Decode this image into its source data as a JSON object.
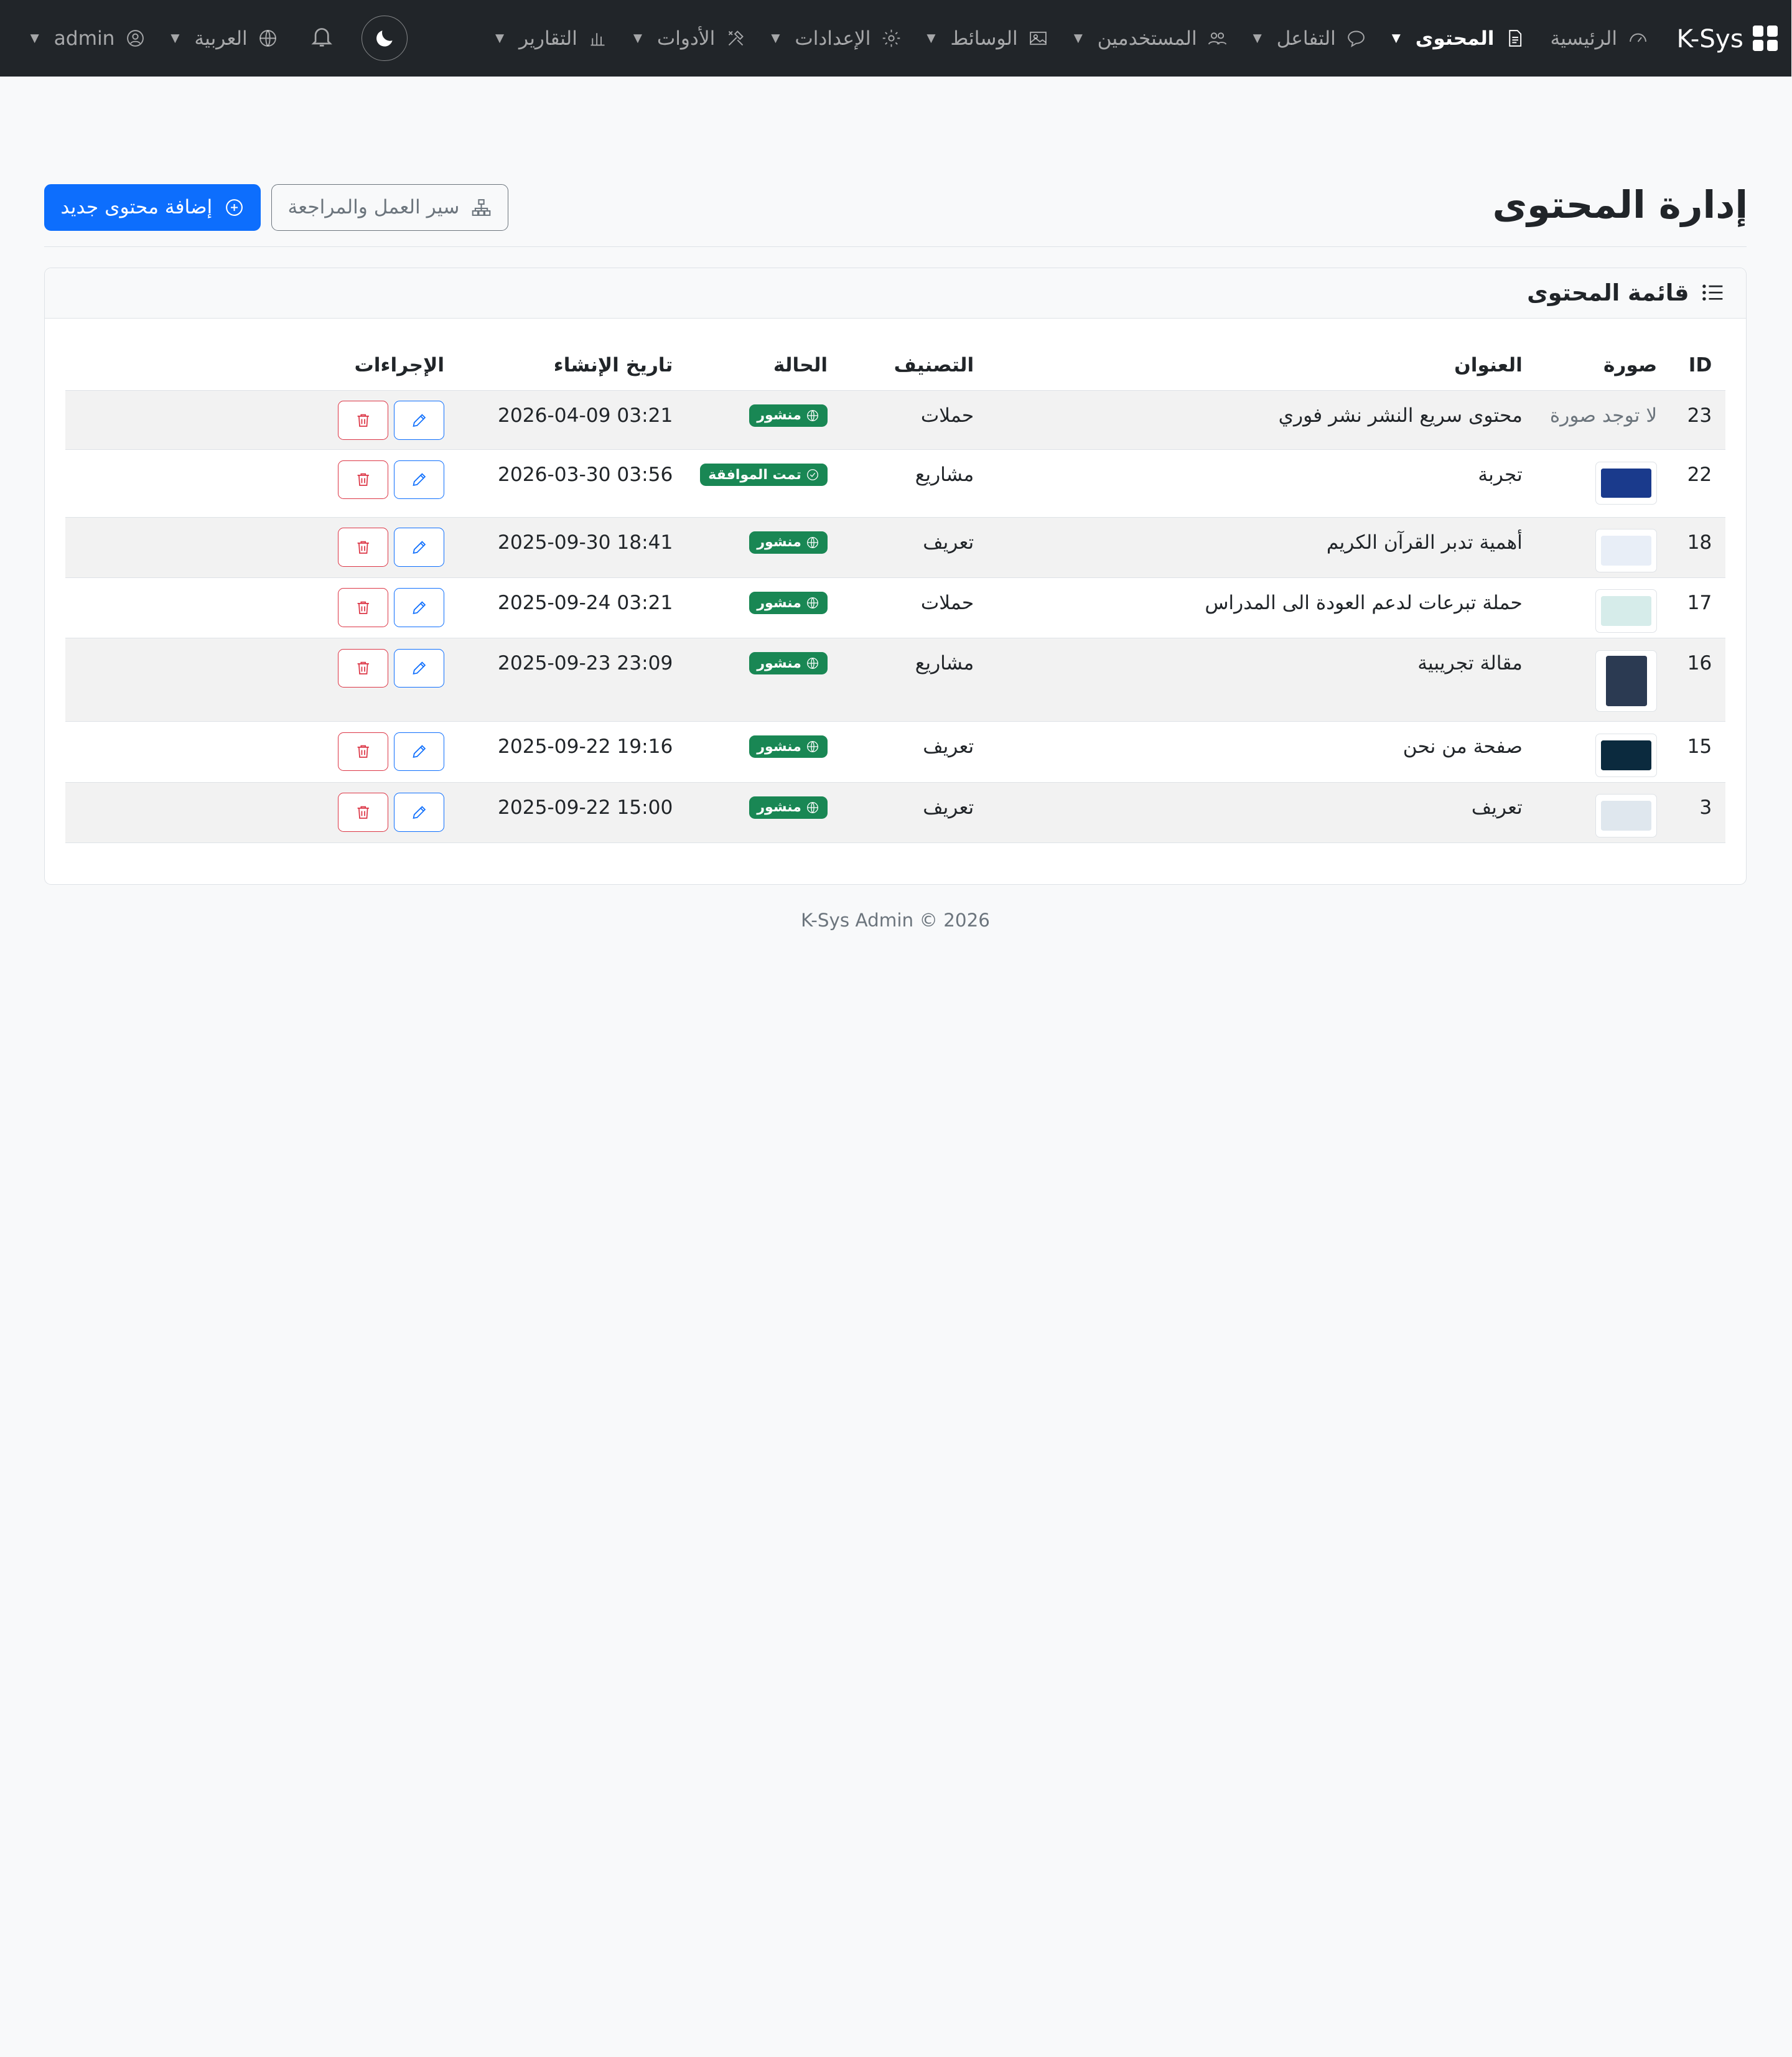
{
  "navbar": {
    "brand": "K-Sys",
    "items": [
      {
        "label": "الرئيسية",
        "icon": "speedometer-icon",
        "dropdown": false,
        "active": false
      },
      {
        "label": "المحتوى",
        "icon": "file-text-icon",
        "dropdown": true,
        "active": true
      },
      {
        "label": "التفاعل",
        "icon": "chat-icon",
        "dropdown": true,
        "active": false
      },
      {
        "label": "المستخدمين",
        "icon": "people-icon",
        "dropdown": true,
        "active": false
      },
      {
        "label": "الوسائط",
        "icon": "image-icon",
        "dropdown": true,
        "active": false
      },
      {
        "label": "الإعدادات",
        "icon": "gear-icon",
        "dropdown": true,
        "active": false
      },
      {
        "label": "الأدوات",
        "icon": "tools-icon",
        "dropdown": true,
        "active": false
      },
      {
        "label": "التقارير",
        "icon": "bar-chart-icon",
        "dropdown": true,
        "active": false
      }
    ],
    "language": "العربية",
    "user": "admin"
  },
  "header": {
    "title": "إدارة المحتوى",
    "workflow_button": "سير العمل والمراجعة",
    "add_button": "إضافة محتوى جديد"
  },
  "card": {
    "title": "قائمة المحتوى",
    "columns": [
      "ID",
      "صورة",
      "العنوان",
      "التصنيف",
      "الحالة",
      "تاريخ الإنشاء",
      "الإجراءات"
    ],
    "rows": [
      {
        "id": "23",
        "image": "none",
        "image_text": "لا توجد صورة",
        "title": "محتوى سريع النشر نشر فوري",
        "category": "حملات",
        "status": "منشور",
        "status_kind": "published",
        "date": "2026-04-09 03:21",
        "thumb_color": ""
      },
      {
        "id": "22",
        "image": "thumb",
        "image_text": "",
        "title": "تجربة",
        "category": "مشاريع",
        "status": "تمت الموافقة",
        "status_kind": "approved",
        "date": "2026-03-30 03:56",
        "thumb_color": "#1a3a8c"
      },
      {
        "id": "18",
        "image": "thumb",
        "image_text": "",
        "title": "أهمية تدبر القرآن الكريم",
        "category": "تعريف",
        "status": "منشور",
        "status_kind": "published",
        "date": "2025-09-30 18:41",
        "thumb_color": "#e8eef7"
      },
      {
        "id": "17",
        "image": "thumb",
        "image_text": "",
        "title": "حملة تبرعات لدعم العودة الى المدراس",
        "category": "حملات",
        "status": "منشور",
        "status_kind": "published",
        "date": "2025-09-24 03:21",
        "thumb_color": "#d6ecea"
      },
      {
        "id": "16",
        "image": "thumb-tall",
        "image_text": "",
        "title": "مقالة تجريبية",
        "category": "مشاريع",
        "status": "منشور",
        "status_kind": "published",
        "date": "2025-09-23 23:09",
        "thumb_color": "#2b3a52"
      },
      {
        "id": "15",
        "image": "thumb",
        "image_text": "",
        "title": "صفحة من نحن",
        "category": "تعريف",
        "status": "منشور",
        "status_kind": "published",
        "date": "2025-09-22 19:16",
        "thumb_color": "#0b2a3e"
      },
      {
        "id": "3",
        "image": "thumb",
        "image_text": "",
        "title": "تعريف",
        "category": "تعريف",
        "status": "منشور",
        "status_kind": "published",
        "date": "2025-09-22 15:00",
        "thumb_color": "#dfe7ee"
      }
    ]
  },
  "footer": "K-Sys Admin © 2026",
  "colors": {
    "primary": "#0d6efd",
    "success": "#198754",
    "danger": "#dc3545",
    "navbar": "#212529"
  }
}
